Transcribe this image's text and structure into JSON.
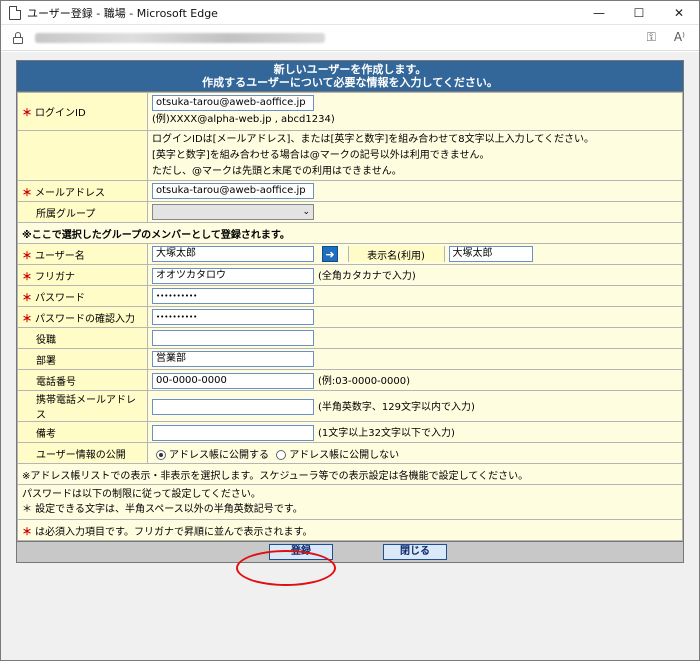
{
  "window": {
    "title": "ユーザー登録 - 職場 - Microsoft Edge",
    "controls": {
      "minimize": "—",
      "maximize": "☐",
      "close": "✕"
    },
    "address_icons": [
      "key-icon",
      "read-aloud-icon"
    ]
  },
  "header": {
    "line1": "新しいユーザーを作成します。",
    "line2": "作成するユーザーについて必要な情報を入力してください。"
  },
  "form": {
    "login_id": {
      "label": "ログインID",
      "value": "otsuka-tarou@aweb-aoffice.jp",
      "example": "(例)XXXX@alpha-web.jp , abcd1234)"
    },
    "login_help": [
      "ログインIDは[メールアドレス]、または[英字と数字]を組み合わせて8文字以上入力してください。",
      "[英字と数字]を組み合わせる場合は@マークの記号以外は利用できません。",
      "ただし、@マークは先頭と末尾での利用はできません。"
    ],
    "email": {
      "label": "メールアドレス",
      "value": "otsuka-tarou@aweb-aoffice.jp"
    },
    "group": {
      "label": "所属グループ",
      "value": ""
    },
    "group_note": "※ここで選択したグループのメンバーとして登録されます。",
    "username": {
      "label": "ユーザー名",
      "value": "大塚太郎",
      "arrow": "➜"
    },
    "display_name": {
      "label": "表示名(利用)",
      "value": "大塚太郎"
    },
    "furigana": {
      "label": "フリガナ",
      "value": "オオツカタロウ",
      "note": "(全角カタカナで入力)"
    },
    "password": {
      "label": "パスワード",
      "value": "••••••••••"
    },
    "password_confirm": {
      "label": "パスワードの確認入力",
      "value": "••••••••••"
    },
    "position": {
      "label": "役職",
      "value": ""
    },
    "department": {
      "label": "部署",
      "value": "営業部"
    },
    "phone": {
      "label": "電話番号",
      "value": "00-0000-0000",
      "note": "(例:03-0000-0000)"
    },
    "mobile_mail": {
      "label": "携帯電話メールアドレス",
      "value": "",
      "note": "(半角英数字、129文字以内で入力)"
    },
    "remarks": {
      "label": "備考",
      "value": "",
      "note": "(1文字以上32文字以下で入力)"
    },
    "publish": {
      "label": "ユーザー情報の公開",
      "opt1": "アドレス帳に公開する",
      "opt2": "アドレス帳に公開しない"
    },
    "publish_note": "※アドレス帳リストでの表示・非表示を選択します。スケジューラ等での表示設定は各機能で設定してください。",
    "pw_rules": [
      "パスワードは以下の制限に従って設定してください。",
      "＊ 設定できる文字は、半角スペース以外の半角英数記号です。"
    ],
    "required_note": "は必須入力項目です。フリガナで昇順に並んで表示されます。",
    "req_mark": "＊"
  },
  "buttons": {
    "register": "登録",
    "close": "閉じる"
  },
  "colors": {
    "header_bg": "#336699",
    "form_bg": "#fffde0",
    "required": "#cc0000",
    "highlight_circle": "#e01010"
  }
}
